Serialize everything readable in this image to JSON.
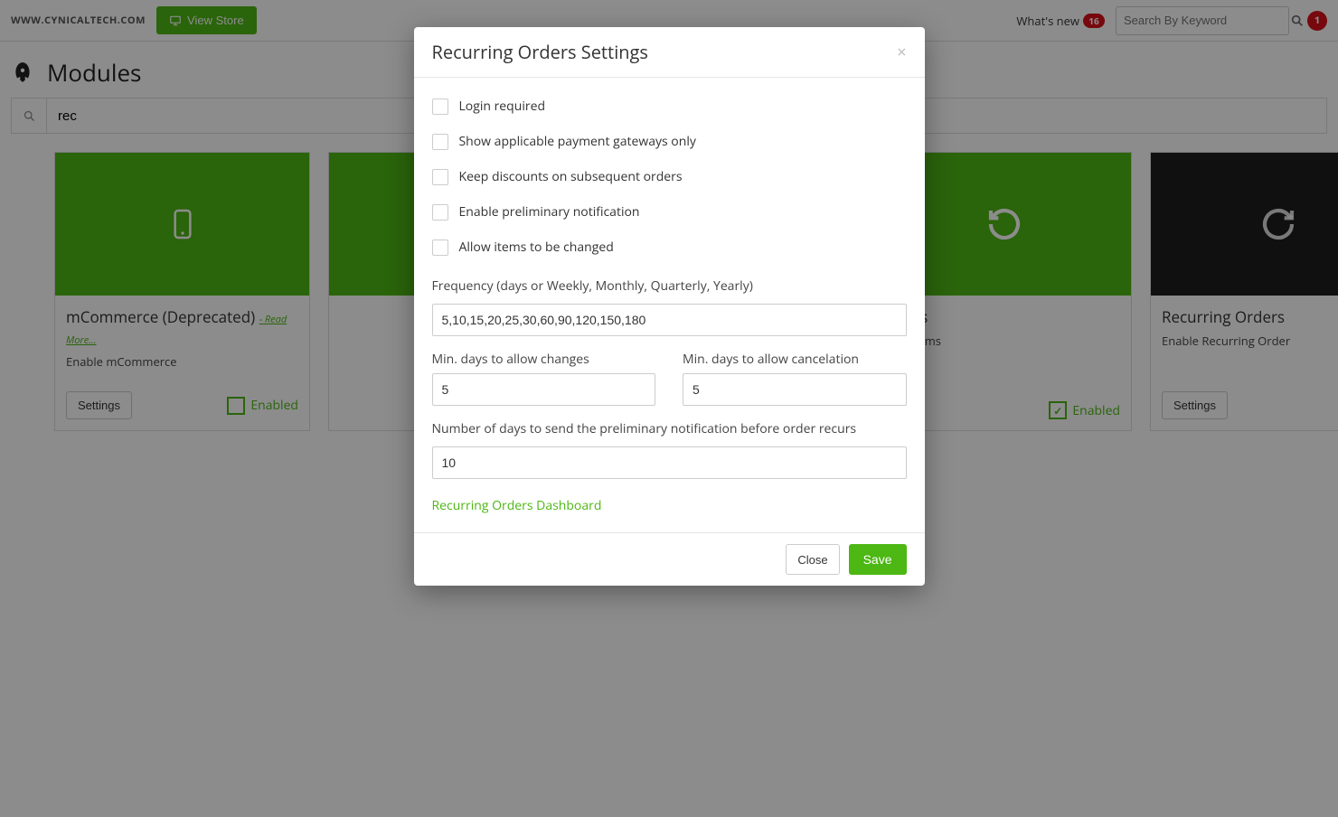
{
  "topbar": {
    "sitename": "WWW.CYNICALTECH.COM",
    "view_store": "View Store",
    "whatsnew": "What's new",
    "whatsnew_badge": "16",
    "search_placeholder": "Search By Keyword",
    "notif_badge": "1"
  },
  "page": {
    "title": "Modules",
    "filter_value": "rec"
  },
  "modules": [
    {
      "title": "mCommerce (Deprecated)",
      "read_more": "- Read More...",
      "desc": "Enable mCommerce",
      "settings": "Settings",
      "enabled_label": "Enabled",
      "hero": "green",
      "icon": "phone",
      "checked": false
    },
    {
      "title": "",
      "read_more": "",
      "desc": "",
      "settings": "",
      "enabled_label": "",
      "hero": "green",
      "icon": "",
      "checked": false
    },
    {
      "title": "",
      "read_more": "",
      "desc": "",
      "settings": "",
      "enabled_label": "",
      "hero": "green",
      "icon": "",
      "checked": false
    },
    {
      "title": "Items",
      "read_more": "",
      "desc": "ved Items",
      "settings": "",
      "enabled_label": "Enabled",
      "hero": "green",
      "icon": "history",
      "checked": true
    },
    {
      "title": "Recurring Orders",
      "read_more": "",
      "desc": "Enable Recurring Order",
      "settings": "Settings",
      "enabled_label": "",
      "hero": "dark",
      "icon": "recur",
      "checked": false
    }
  ],
  "modal": {
    "title": "Recurring Orders Settings",
    "checks": [
      "Login required",
      "Show applicable payment gateways only",
      "Keep discounts on subsequent orders",
      "Enable preliminary notification",
      "Allow items to be changed"
    ],
    "freq_label": "Frequency (days or Weekly, Monthly, Quarterly, Yearly)",
    "freq_value": "5,10,15,20,25,30,60,90,120,150,180",
    "min_changes_label": "Min. days to allow changes",
    "min_changes_value": "5",
    "min_cancel_label": "Min. days to allow cancelation",
    "min_cancel_value": "5",
    "prelim_label": "Number of days to send the preliminary notification before order recurs",
    "prelim_value": "10",
    "dashboard_link": "Recurring Orders Dashboard",
    "close": "Close",
    "save": "Save"
  }
}
